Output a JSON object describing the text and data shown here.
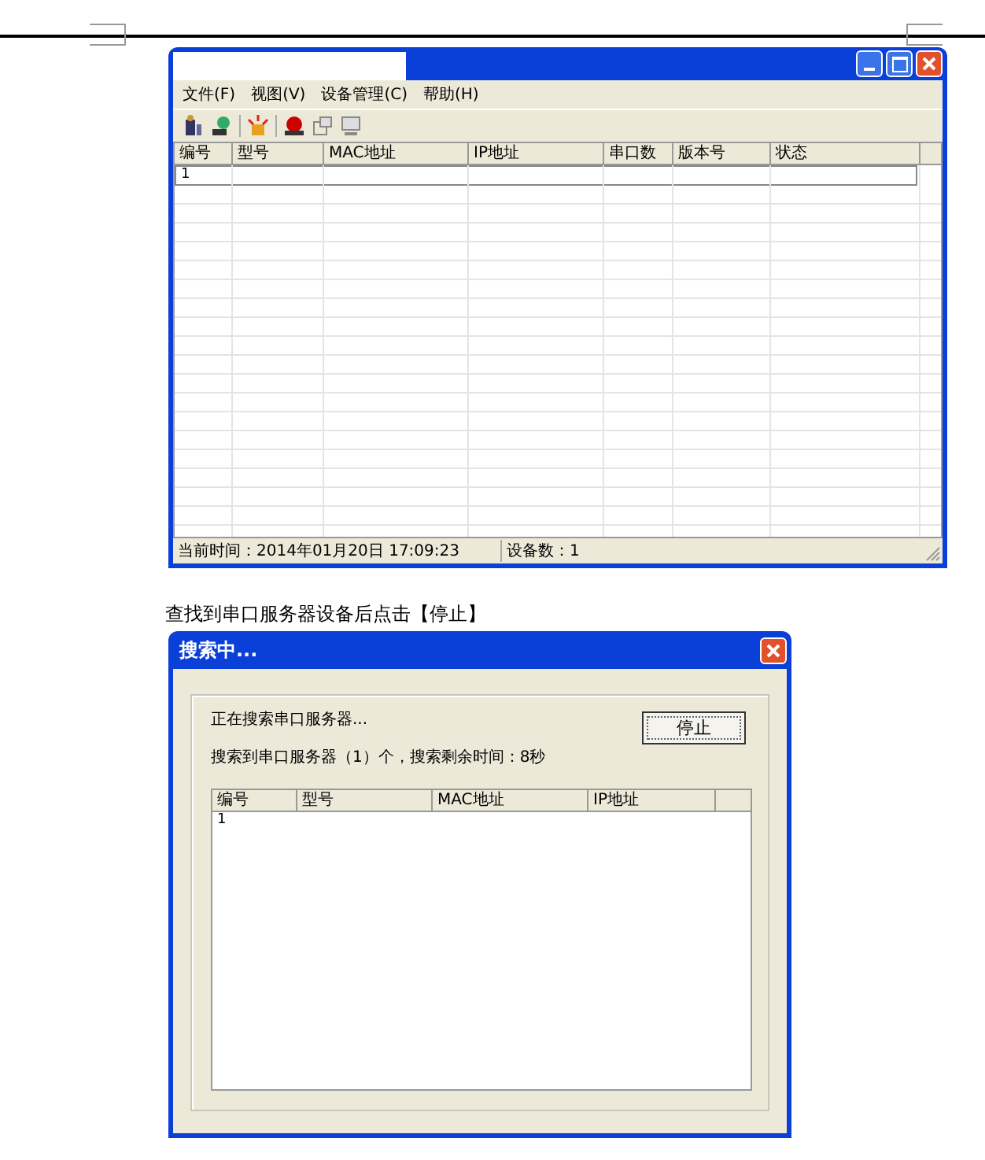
{
  "main_window": {
    "menu": [
      "文件(F)",
      "视图(V)",
      "设备管理(C)",
      "帮助(H)"
    ],
    "table": {
      "columns": [
        "编号",
        "型号",
        "MAC地址",
        "IP地址",
        "串口数",
        "版本号",
        "状态"
      ],
      "rows": [
        {
          "cells": [
            "1"
          ]
        }
      ]
    },
    "status_bar": [
      "当前时间：2014年01月20日 17:09:23",
      "设备数：1"
    ]
  },
  "caption": "查找到串口服务器设备后点击【停止】",
  "dialog": {
    "title": "搜索中...",
    "status_lines": [
      "正在搜索串口服务器...",
      "搜索到串口服务器（1）个，搜索剩余时间：8秒"
    ],
    "stop_button": "停止",
    "table": {
      "columns": [
        "编号",
        "型号",
        "MAC地址",
        "IP地址"
      ],
      "rows": [
        {
          "cells": [
            "1"
          ]
        }
      ]
    }
  }
}
